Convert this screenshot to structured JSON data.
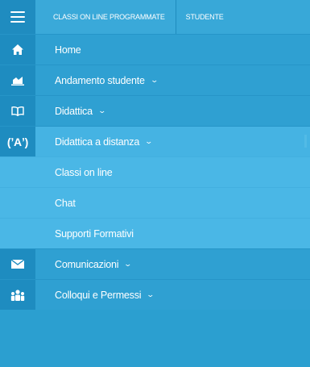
{
  "topbar": {
    "tabs": [
      {
        "label": "CLASSI ON LINE PROGRAMMATE"
      },
      {
        "label": "STUDENTE"
      }
    ]
  },
  "menu": {
    "items": [
      {
        "label": "Home",
        "icon": "home-icon"
      },
      {
        "label": "Andamento studente",
        "icon": "chart-icon",
        "chevron": "⌄"
      },
      {
        "label": "Didattica",
        "icon": "book-icon",
        "chevron": "⌄"
      },
      {
        "label": "Didattica a distanza",
        "icon": "broadcast-icon",
        "chevron": "⌄",
        "icon_text": "(ʼAʼ)"
      },
      {
        "label": "Classi on line"
      },
      {
        "label": "Chat"
      },
      {
        "label": "Supporti Formativi"
      },
      {
        "label": "Comunicazioni",
        "icon": "envelope-icon",
        "chevron": "⌄"
      },
      {
        "label": "Colloqui e Permessi",
        "icon": "people-icon",
        "chevron": "⌄"
      }
    ]
  },
  "colors": {
    "menu_bg": "#2fa0d2",
    "icon_column": "#1e8cc0",
    "submenu_bg": "#4ab7e6",
    "text": "#ffffff"
  }
}
